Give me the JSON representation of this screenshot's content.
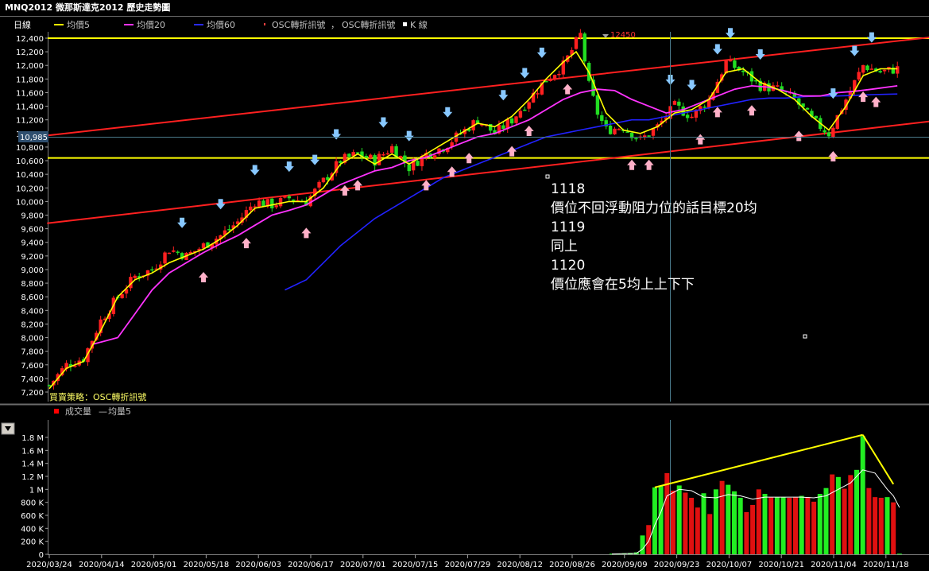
{
  "window": {
    "title": "MNQ2012 微那斯達克2012  歷史走勢圖"
  },
  "legend": {
    "period": "日線",
    "ma5": "均價5",
    "ma20": "均價20",
    "ma60": "均價60",
    "osc1": "OSC轉折訊號",
    "osc2": "OSC轉折訊號",
    "k": "K 線",
    "ma5_color": "#ffff00",
    "ma20_color": "#ff33ff",
    "ma60_color": "#2222ff"
  },
  "strategy_label": "買賣策略：OSC轉折訊號",
  "current_price_label": "10,985",
  "peak_label": "12450",
  "annotation": {
    "lines": [
      "1118",
      "價位不回浮動阻力位的話目標20均",
      "1119",
      "同上",
      "1120",
      "價位應會在5均上上下下"
    ]
  },
  "volume_legend": {
    "vol": "成交量",
    "avg": "均量5"
  },
  "chart_data": [
    {
      "type": "candlestick",
      "title": "MNQ2012 微那斯達克2012  歷史走勢圖",
      "period": "日線",
      "ylim": [
        7100,
        12550
      ],
      "y_ticks": [
        7200,
        7400,
        7600,
        7800,
        8000,
        8200,
        8400,
        8600,
        8800,
        9000,
        9200,
        9400,
        9600,
        9800,
        10000,
        10200,
        10400,
        10600,
        10800,
        11000,
        11200,
        11400,
        11600,
        11800,
        12000,
        12200,
        12400
      ],
      "y_tick_labels": [
        "7,200",
        "7,400",
        "7,600",
        "7,800",
        "8,000",
        "8,200",
        "8,400",
        "8,600",
        "8,800",
        "9,000",
        "9,200",
        "9,400",
        "9,600",
        "9,800",
        "10,000",
        "10,200",
        "10,400",
        "10,600",
        "10,800",
        "11,000",
        "11,200",
        "11,400",
        "11,600",
        "11,800",
        "12,000",
        "12,200",
        "12,400"
      ],
      "x_tick_labels": [
        "2020/03/24",
        "2020/04/14",
        "2020/05/01",
        "2020/05/18",
        "2020/06/03",
        "2020/06/17",
        "2020/07/01",
        "2020/07/15",
        "2020/07/29",
        "2020/08/12",
        "2020/08/26",
        "2020/09/09",
        "2020/09/23",
        "2020/10/07",
        "2020/10/21",
        "2020/11/04",
        "2020/11/18"
      ],
      "horizontal_lines": [
        12400,
        10640
      ],
      "current_price": 10985,
      "peak": 12450,
      "close_path": [
        [
          0,
          7300
        ],
        [
          4,
          7600
        ],
        [
          8,
          7700
        ],
        [
          12,
          8250
        ],
        [
          16,
          8600
        ],
        [
          20,
          8900
        ],
        [
          24,
          9000
        ],
        [
          28,
          9300
        ],
        [
          32,
          9200
        ],
        [
          36,
          9350
        ],
        [
          40,
          9500
        ],
        [
          44,
          9700
        ],
        [
          48,
          10000
        ],
        [
          52,
          9950
        ],
        [
          56,
          10050
        ],
        [
          60,
          10000
        ],
        [
          64,
          10300
        ],
        [
          68,
          10600
        ],
        [
          72,
          10700
        ],
        [
          76,
          10600
        ],
        [
          80,
          10800
        ],
        [
          84,
          10500
        ],
        [
          88,
          10700
        ],
        [
          92,
          10800
        ],
        [
          96,
          11000
        ],
        [
          100,
          11200
        ],
        [
          104,
          11000
        ],
        [
          108,
          11200
        ],
        [
          112,
          11500
        ],
        [
          116,
          11800
        ],
        [
          120,
          12000
        ],
        [
          124,
          12450
        ],
        [
          126,
          11700
        ],
        [
          128,
          11300
        ],
        [
          130,
          11050
        ],
        [
          134,
          11100
        ],
        [
          138,
          10900
        ],
        [
          142,
          11100
        ],
        [
          146,
          11400
        ],
        [
          150,
          11250
        ],
        [
          154,
          11500
        ],
        [
          158,
          12050
        ],
        [
          162,
          11900
        ],
        [
          166,
          11700
        ],
        [
          170,
          11650
        ],
        [
          174,
          11500
        ],
        [
          178,
          11200
        ],
        [
          182,
          11000
        ],
        [
          186,
          11500
        ],
        [
          190,
          12000
        ],
        [
          194,
          11900
        ],
        [
          198,
          11950
        ]
      ],
      "ma5": [
        [
          0,
          7250
        ],
        [
          4,
          7550
        ],
        [
          8,
          7650
        ],
        [
          12,
          8100
        ],
        [
          16,
          8600
        ],
        [
          20,
          8850
        ],
        [
          24,
          8950
        ],
        [
          28,
          9100
        ],
        [
          32,
          9200
        ],
        [
          36,
          9300
        ],
        [
          40,
          9450
        ],
        [
          44,
          9650
        ],
        [
          48,
          9900
        ],
        [
          52,
          9950
        ],
        [
          56,
          10000
        ],
        [
          60,
          10000
        ],
        [
          64,
          10200
        ],
        [
          68,
          10550
        ],
        [
          72,
          10700
        ],
        [
          76,
          10550
        ],
        [
          80,
          10700
        ],
        [
          84,
          10550
        ],
        [
          88,
          10700
        ],
        [
          92,
          10850
        ],
        [
          96,
          11000
        ],
        [
          100,
          11150
        ],
        [
          104,
          11100
        ],
        [
          108,
          11250
        ],
        [
          112,
          11500
        ],
        [
          116,
          11800
        ],
        [
          120,
          12050
        ],
        [
          123,
          12200
        ],
        [
          126,
          11900
        ],
        [
          130,
          11300
        ],
        [
          134,
          11050
        ],
        [
          138,
          11000
        ],
        [
          142,
          11100
        ],
        [
          146,
          11300
        ],
        [
          150,
          11350
        ],
        [
          154,
          11500
        ],
        [
          158,
          11900
        ],
        [
          162,
          11950
        ],
        [
          166,
          11750
        ],
        [
          170,
          11650
        ],
        [
          174,
          11500
        ],
        [
          178,
          11250
        ],
        [
          182,
          11050
        ],
        [
          186,
          11400
        ],
        [
          190,
          11850
        ],
        [
          194,
          11950
        ],
        [
          198,
          11950
        ]
      ],
      "ma20": [
        [
          10,
          7900
        ],
        [
          16,
          8000
        ],
        [
          20,
          8350
        ],
        [
          24,
          8700
        ],
        [
          28,
          8950
        ],
        [
          32,
          9100
        ],
        [
          36,
          9250
        ],
        [
          40,
          9380
        ],
        [
          44,
          9500
        ],
        [
          48,
          9650
        ],
        [
          52,
          9800
        ],
        [
          56,
          9870
        ],
        [
          60,
          9950
        ],
        [
          64,
          10100
        ],
        [
          68,
          10250
        ],
        [
          72,
          10350
        ],
        [
          76,
          10450
        ],
        [
          80,
          10500
        ],
        [
          84,
          10600
        ],
        [
          88,
          10650
        ],
        [
          92,
          10750
        ],
        [
          96,
          10850
        ],
        [
          100,
          10950
        ],
        [
          104,
          11000
        ],
        [
          108,
          11100
        ],
        [
          112,
          11200
        ],
        [
          116,
          11350
        ],
        [
          120,
          11500
        ],
        [
          124,
          11600
        ],
        [
          128,
          11650
        ],
        [
          132,
          11630
        ],
        [
          136,
          11500
        ],
        [
          140,
          11400
        ],
        [
          144,
          11300
        ],
        [
          148,
          11350
        ],
        [
          152,
          11450
        ],
        [
          156,
          11550
        ],
        [
          160,
          11650
        ],
        [
          164,
          11700
        ],
        [
          168,
          11680
        ],
        [
          172,
          11620
        ],
        [
          176,
          11550
        ],
        [
          180,
          11550
        ],
        [
          184,
          11600
        ],
        [
          188,
          11620
        ],
        [
          192,
          11650
        ],
        [
          198,
          11700
        ]
      ],
      "ma60": [
        [
          55,
          8700
        ],
        [
          60,
          8850
        ],
        [
          64,
          9100
        ],
        [
          68,
          9350
        ],
        [
          72,
          9550
        ],
        [
          76,
          9750
        ],
        [
          80,
          9900
        ],
        [
          84,
          10050
        ],
        [
          88,
          10200
        ],
        [
          92,
          10350
        ],
        [
          96,
          10450
        ],
        [
          100,
          10550
        ],
        [
          104,
          10650
        ],
        [
          108,
          10750
        ],
        [
          112,
          10850
        ],
        [
          116,
          10950
        ],
        [
          120,
          11000
        ],
        [
          124,
          11050
        ],
        [
          128,
          11100
        ],
        [
          132,
          11150
        ],
        [
          136,
          11200
        ],
        [
          140,
          11200
        ],
        [
          144,
          11250
        ],
        [
          148,
          11300
        ],
        [
          152,
          11350
        ],
        [
          156,
          11400
        ],
        [
          160,
          11450
        ],
        [
          164,
          11500
        ],
        [
          168,
          11520
        ],
        [
          172,
          11520
        ],
        [
          176,
          11540
        ],
        [
          180,
          11550
        ],
        [
          184,
          11550
        ],
        [
          188,
          11560
        ],
        [
          192,
          11570
        ],
        [
          198,
          11580
        ]
      ]
    },
    {
      "type": "bar",
      "title": "成交量",
      "series_names": [
        "成交量",
        "均量5"
      ],
      "ylim": [
        0,
        1850000
      ],
      "y_ticks": [
        0,
        200000,
        400000,
        600000,
        800000,
        1000000,
        1200000,
        1400000,
        1600000,
        1800000
      ],
      "y_tick_labels": [
        "0",
        "200 K",
        "400 K",
        "600 K",
        "800 K",
        "1 M",
        "1.2 M",
        "1.4 M",
        "1.6 M",
        "1.8 M"
      ],
      "bars": [
        {
          "v": 10000,
          "c": "g"
        },
        {
          "v": 10000,
          "c": "g"
        },
        {
          "v": 15000,
          "c": "g"
        },
        {
          "v": 20000,
          "c": "g"
        },
        {
          "v": 30000,
          "c": "g"
        },
        {
          "v": 290000,
          "c": "g"
        },
        {
          "v": 450000,
          "c": "r"
        },
        {
          "v": 1030000,
          "c": "g"
        },
        {
          "v": 1050000,
          "c": "g"
        },
        {
          "v": 1250000,
          "c": "r"
        },
        {
          "v": 980000,
          "c": "r"
        },
        {
          "v": 1060000,
          "c": "g"
        },
        {
          "v": 950000,
          "c": "r"
        },
        {
          "v": 870000,
          "c": "r"
        },
        {
          "v": 720000,
          "c": "r"
        },
        {
          "v": 940000,
          "c": "g"
        },
        {
          "v": 620000,
          "c": "r"
        },
        {
          "v": 1000000,
          "c": "g"
        },
        {
          "v": 1130000,
          "c": "r"
        },
        {
          "v": 1070000,
          "c": "g"
        },
        {
          "v": 970000,
          "c": "g"
        },
        {
          "v": 870000,
          "c": "g"
        },
        {
          "v": 650000,
          "c": "r"
        },
        {
          "v": 760000,
          "c": "r"
        },
        {
          "v": 1000000,
          "c": "r"
        },
        {
          "v": 930000,
          "c": "g"
        },
        {
          "v": 880000,
          "c": "r"
        },
        {
          "v": 880000,
          "c": "g"
        },
        {
          "v": 880000,
          "c": "g"
        },
        {
          "v": 870000,
          "c": "r"
        },
        {
          "v": 880000,
          "c": "r"
        },
        {
          "v": 900000,
          "c": "g"
        },
        {
          "v": 880000,
          "c": "r"
        },
        {
          "v": 810000,
          "c": "r"
        },
        {
          "v": 930000,
          "c": "g"
        },
        {
          "v": 1020000,
          "c": "g"
        },
        {
          "v": 1230000,
          "c": "r"
        },
        {
          "v": 1190000,
          "c": "g"
        },
        {
          "v": 1010000,
          "c": "r"
        },
        {
          "v": 1220000,
          "c": "r"
        },
        {
          "v": 1300000,
          "c": "g"
        },
        {
          "v": 1820000,
          "c": "g"
        },
        {
          "v": 1020000,
          "c": "r"
        },
        {
          "v": 880000,
          "c": "r"
        },
        {
          "v": 870000,
          "c": "r"
        },
        {
          "v": 880000,
          "c": "g"
        },
        {
          "v": 800000,
          "c": "r"
        },
        {
          "v": 10000,
          "c": "g"
        }
      ],
      "avg5": [
        [
          0,
          5000
        ],
        [
          4,
          15000
        ],
        [
          5,
          80000
        ],
        [
          6,
          200000
        ],
        [
          7,
          450000
        ],
        [
          8,
          650000
        ],
        [
          9,
          900000
        ],
        [
          10,
          950000
        ],
        [
          11,
          1000000
        ],
        [
          13,
          980000
        ],
        [
          15,
          880000
        ],
        [
          17,
          870000
        ],
        [
          19,
          920000
        ],
        [
          21,
          900000
        ],
        [
          23,
          850000
        ],
        [
          25,
          880000
        ],
        [
          27,
          880000
        ],
        [
          29,
          880000
        ],
        [
          31,
          880000
        ],
        [
          33,
          870000
        ],
        [
          35,
          900000
        ],
        [
          37,
          1000000
        ],
        [
          39,
          1100000
        ],
        [
          41,
          1300000
        ],
        [
          43,
          1250000
        ],
        [
          45,
          1000000
        ],
        [
          46,
          900000
        ],
        [
          47,
          720000
        ]
      ]
    }
  ]
}
